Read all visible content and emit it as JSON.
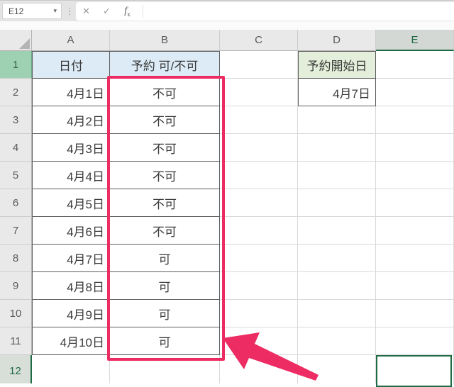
{
  "titlebar": {
    "name_box": "E12",
    "formula_value": ""
  },
  "icons": {
    "dropdown": "▾",
    "more": "⋮",
    "cancel": "✕",
    "enter": "✓",
    "function_f": "f",
    "function_x": "x"
  },
  "columns": [
    "A",
    "B",
    "C",
    "D",
    "E"
  ],
  "rows": [
    "1",
    "2",
    "3",
    "4",
    "5",
    "6",
    "7",
    "8",
    "9",
    "10",
    "11",
    "12"
  ],
  "selection": {
    "active_cell": "E12",
    "selected_column": "E",
    "selected_row": "12"
  },
  "table": {
    "date_header": "日付",
    "status_header": "予約 可/不可",
    "entries": [
      {
        "date": "4月1日",
        "status": "不可"
      },
      {
        "date": "4月2日",
        "status": "不可"
      },
      {
        "date": "4月3日",
        "status": "不可"
      },
      {
        "date": "4月4日",
        "status": "不可"
      },
      {
        "date": "4月5日",
        "status": "不可"
      },
      {
        "date": "4月6日",
        "status": "不可"
      },
      {
        "date": "4月7日",
        "status": "可"
      },
      {
        "date": "4月8日",
        "status": "可"
      },
      {
        "date": "4月9日",
        "status": "可"
      },
      {
        "date": "4月10日",
        "status": "可"
      }
    ]
  },
  "start_date": {
    "label": "予約開始日",
    "value": "4月7日"
  },
  "colors": {
    "highlight_pink": "#EC2C62",
    "selection_green": "#1F6B44",
    "fill_blue": "#DCEBF6",
    "fill_green": "#E3EFDA"
  }
}
